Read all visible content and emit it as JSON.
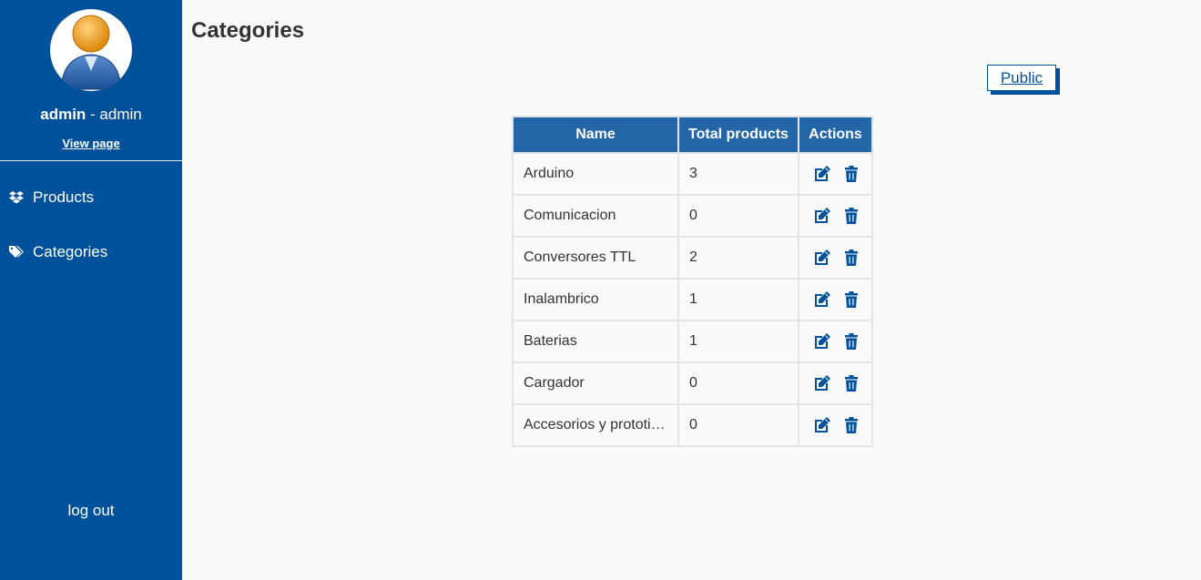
{
  "sidebar": {
    "user_name": "admin",
    "user_role": " - admin",
    "view_page_label": "View page",
    "nav": [
      {
        "label": "Products",
        "icon": "dropbox-icon"
      },
      {
        "label": "Categories",
        "icon": "tags-icon"
      }
    ],
    "logout_label": "log out"
  },
  "main": {
    "title": "Categories",
    "public_button": "Public",
    "table": {
      "headers": [
        "Name",
        "Total products",
        "Actions"
      ],
      "rows": [
        {
          "name": "Arduino",
          "total": "3"
        },
        {
          "name": "Comunicacion",
          "total": "0"
        },
        {
          "name": "Conversores TTL",
          "total": "2"
        },
        {
          "name": "Inalambrico",
          "total": "1"
        },
        {
          "name": "Baterias",
          "total": "1"
        },
        {
          "name": "Cargador",
          "total": "0"
        },
        {
          "name": "Accesorios y prototi…",
          "total": "0"
        }
      ]
    }
  },
  "colors": {
    "sidebar_bg": "#00519c",
    "table_header_bg": "#2366a8",
    "accent": "#00519c"
  }
}
